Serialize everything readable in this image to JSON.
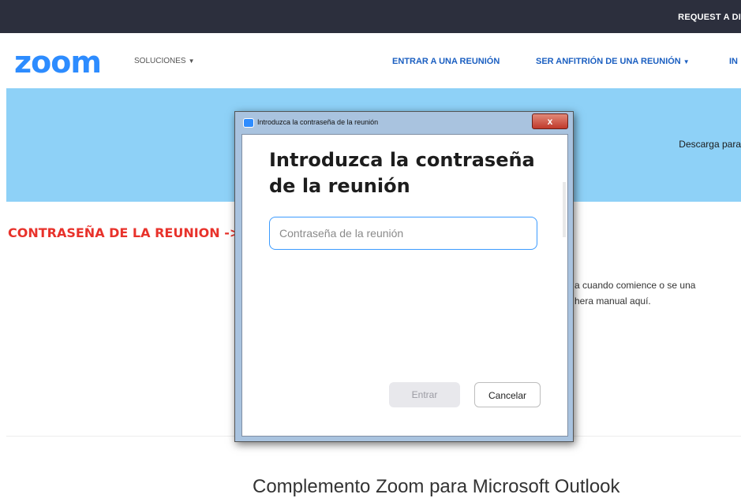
{
  "topbar": {
    "request_label": "REQUEST A DI"
  },
  "nav": {
    "logo": "zoom",
    "solutions": "SOLUCIONES",
    "join": "ENTRAR A UNA REUNIÓN",
    "host": "SER ANFITRIÓN DE UNA REUNIÓN",
    "truncated": "IN"
  },
  "banner": {
    "download_text": "Descarga para"
  },
  "annotation": "CONTRASEÑA DE LA REUNION ->",
  "background": {
    "line1": "a cuando comience o se una",
    "line2": "hera manual aquí.",
    "outlook_title": "Complemento Zoom para Microsoft Outlook"
  },
  "dialog": {
    "window_title": "Introduzca la contraseña de la reunión",
    "heading": "Introduzca la contraseña de la reunión",
    "password_placeholder": "Contraseña de la reunión",
    "enter_label": "Entrar",
    "cancel_label": "Cancelar",
    "close_glyph": "x"
  },
  "colors": {
    "brand": "#2d8cff",
    "banner": "#8ed1f7",
    "annotation": "#e8322b"
  }
}
